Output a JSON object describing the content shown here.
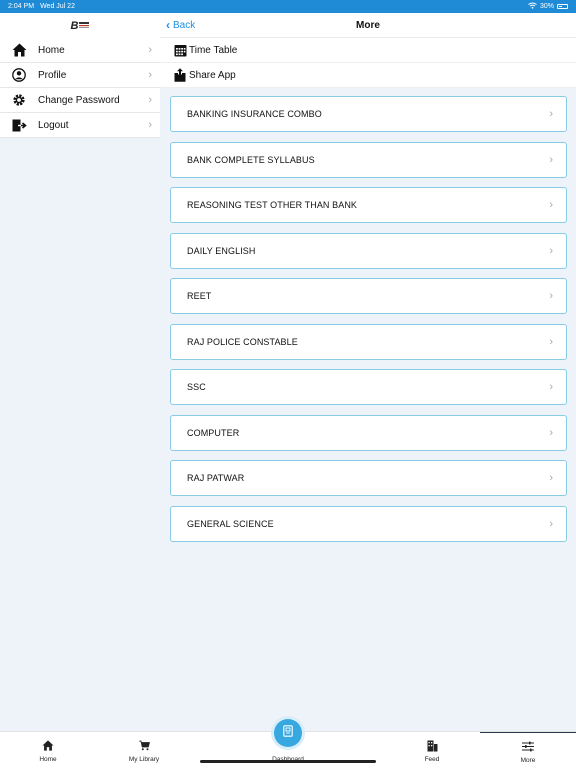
{
  "status_bar": {
    "time": "2:04 PM",
    "date": "Wed Jul 22",
    "battery": "30%"
  },
  "sidebar": {
    "logo_letter": "B",
    "items": [
      {
        "label": "Home",
        "icon": "home-icon"
      },
      {
        "label": "Profile",
        "icon": "profile-icon"
      },
      {
        "label": "Change Password",
        "icon": "gear-icon"
      },
      {
        "label": "Logout",
        "icon": "logout-icon"
      }
    ]
  },
  "navbar": {
    "back_label": "Back",
    "title": "More"
  },
  "top_rows": [
    {
      "label": "Time Table",
      "icon": "calendar-icon"
    },
    {
      "label": "Share App",
      "icon": "share-icon"
    }
  ],
  "courses": [
    "BANKING INSURANCE COMBO",
    "BANK COMPLETE SYLLABUS",
    "REASONING TEST OTHER THAN BANK",
    "DAILY ENGLISH",
    "REET",
    "RAJ POLICE CONSTABLE",
    "SSC",
    "COMPUTER",
    "RAJ PATWAR",
    "GENERAL SCIENCE"
  ],
  "tabs": [
    {
      "label": "Home",
      "icon": "home-icon"
    },
    {
      "label": "My Library",
      "icon": "cart-icon"
    },
    {
      "label": "Dashboard",
      "icon": "dashboard-icon"
    },
    {
      "label": "Feed",
      "icon": "feed-icon"
    },
    {
      "label": "More",
      "icon": "sliders-icon"
    }
  ],
  "colors": {
    "accent": "#1e8fe0",
    "status_bar": "#1f8bd6",
    "card_border": "#88cde6",
    "background": "#eef2f9"
  }
}
